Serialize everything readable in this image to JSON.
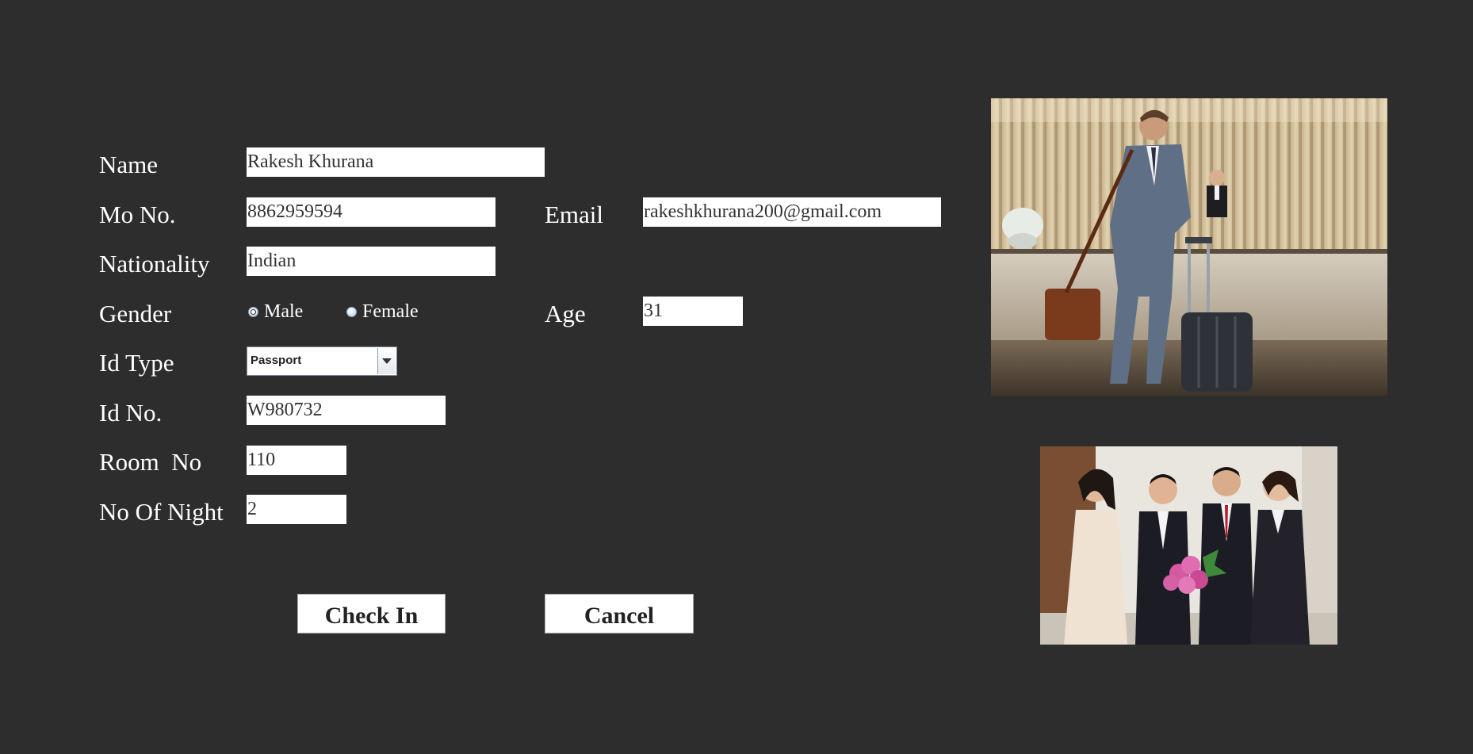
{
  "form": {
    "labels": {
      "name": "Name",
      "mobile": "Mo No.",
      "email": "Email",
      "nationality": "Nationality",
      "gender": "Gender",
      "age": "Age",
      "id_type": "Id Type",
      "id_no": "Id No.",
      "room_no": "Room  No",
      "nights": "No Of Night"
    },
    "values": {
      "name": "Rakesh Khurana",
      "mobile": "8862959594",
      "email": "rakeshkhurana200@gmail.com",
      "nationality": "Indian",
      "age": "31",
      "id_type": "Passport",
      "id_no": "W980732",
      "room_no": "110",
      "nights": "2"
    },
    "gender_options": {
      "male": "Male",
      "female": "Female",
      "selected": "male"
    }
  },
  "buttons": {
    "check_in": "Check In",
    "cancel": "Cancel"
  },
  "colors": {
    "background": "#2d2d2d",
    "field": "#ffffff",
    "text": "#ffffff"
  }
}
